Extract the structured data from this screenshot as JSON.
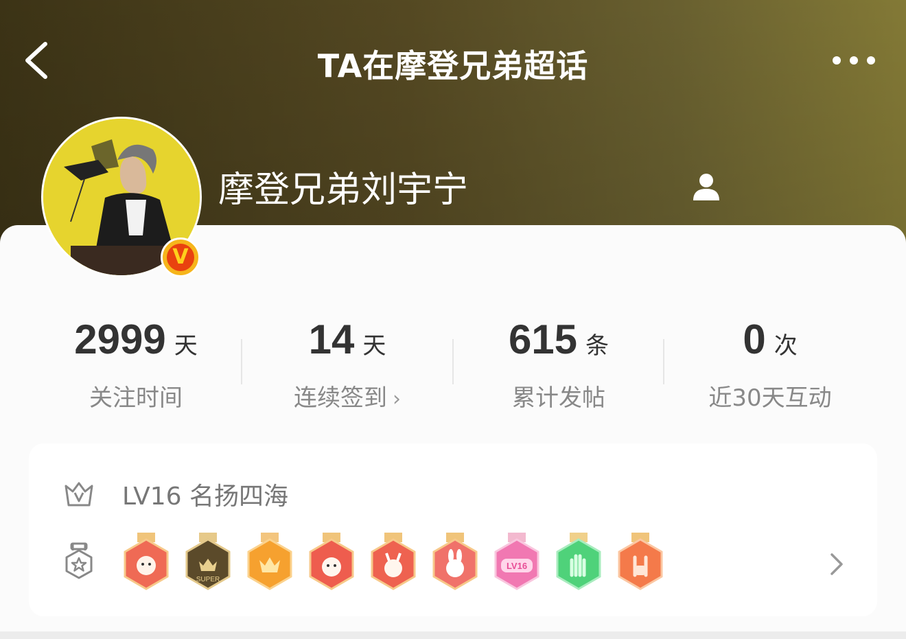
{
  "header": {
    "title": "TA在摩登兄弟超话",
    "back_icon": "chevron-left-icon",
    "more_icon": "more-horizontal-icon"
  },
  "profile": {
    "username": "摩登兄弟刘宇宁",
    "verified_badge_letter": "V",
    "avatar_icon": "user-avatar",
    "person_icon": "person-icon"
  },
  "stats": [
    {
      "value": "2999",
      "unit": "天",
      "label": "关注时间"
    },
    {
      "value": "14",
      "unit": "天",
      "label": "连续签到",
      "chevron": "›"
    },
    {
      "value": "615",
      "unit": "条",
      "label": "累计发帖"
    },
    {
      "value": "0",
      "unit": "次",
      "label": "近30天互动"
    }
  ],
  "level": {
    "text": "LV16 名扬四海",
    "crown_icon": "crown-icon",
    "medal_icon": "medal-icon"
  },
  "badges": [
    {
      "name": "rabbit-badge-red",
      "color": "#ef6a55"
    },
    {
      "name": "super-badge",
      "color": "#5b4a2a",
      "text": "SUPER"
    },
    {
      "name": "crown-badge",
      "color": "#f6a12f"
    },
    {
      "name": "rabbit-badge-red-2",
      "color": "#ee5d4e"
    },
    {
      "name": "rabbit-badge-red-3",
      "color": "#ee6250"
    },
    {
      "name": "bunny-badge",
      "color": "#f0726a"
    },
    {
      "name": "lv16-badge",
      "color": "#f178b2",
      "text": "LV16"
    },
    {
      "name": "hand-badge",
      "color": "#4fd27a"
    },
    {
      "name": "rock-hand-badge",
      "color": "#f47a4a"
    }
  ],
  "colors": {
    "header_start": "#3d3416",
    "header_end": "#867c37",
    "badge_gold": "#f6b51b",
    "badge_red": "#e9420f"
  }
}
